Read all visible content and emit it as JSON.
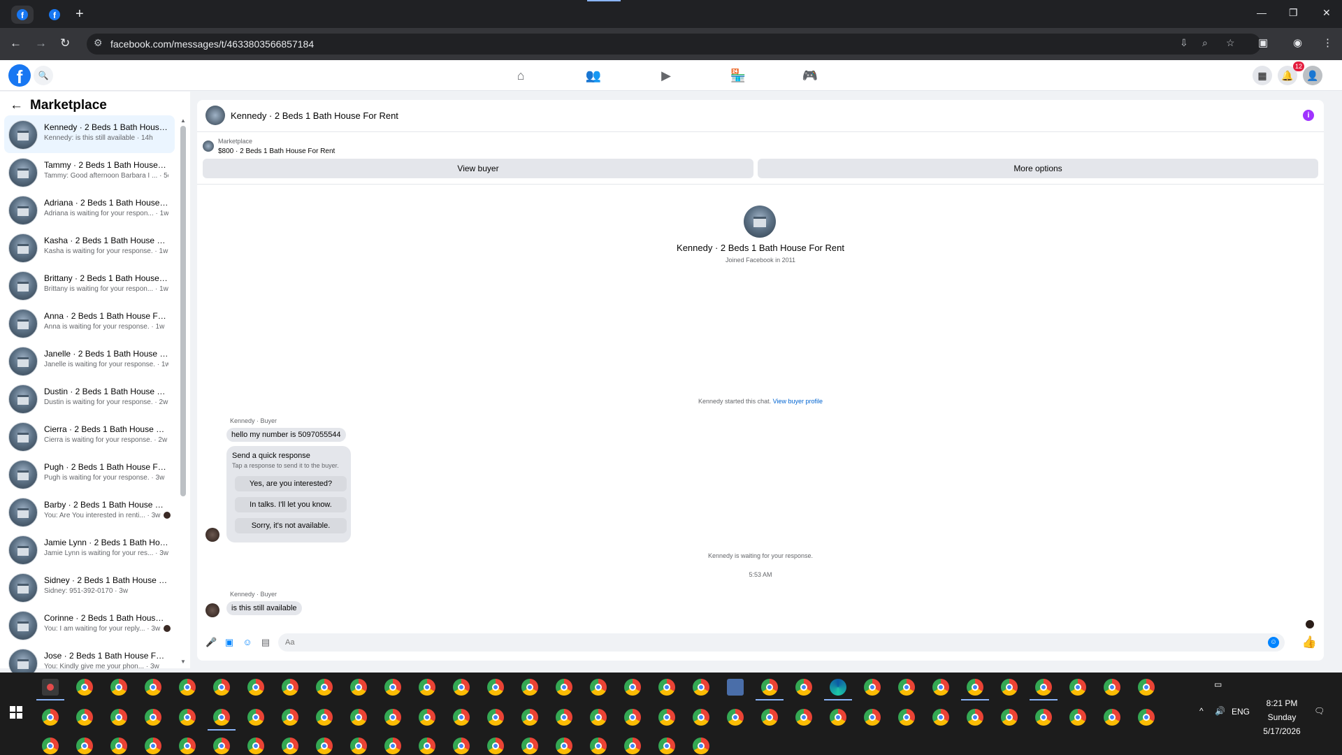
{
  "browser": {
    "url": "facebook.com/messages/t/4633803566857184",
    "tabs": [
      {
        "name": "Facebook tab 1"
      },
      {
        "name": "Facebook tab 2"
      }
    ]
  },
  "fb": {
    "logo": "f",
    "nav_icons": [
      "home-icon",
      "friends-icon",
      "watch-icon",
      "marketplace-icon",
      "gaming-icon"
    ],
    "notifications_count": "12"
  },
  "left": {
    "title": "Marketplace",
    "conversations": [
      {
        "title": "Kennedy · 2 Beds 1 Bath House For Rent",
        "preview": "Kennedy: is this still available · 14h",
        "active": true,
        "dot": false
      },
      {
        "title": "Tammy · 2 Beds 1 Bath House For Rent",
        "preview": "Tammy: Good afternoon Barbara I ... · 5d",
        "active": false,
        "dot": false
      },
      {
        "title": "Adriana · 2 Beds 1 Bath House For Rent",
        "preview": "Adriana is waiting for your respon... · 1w",
        "active": false,
        "dot": false
      },
      {
        "title": "Kasha · 2 Beds 1 Bath House For Rent",
        "preview": "Kasha is waiting for your response. · 1w",
        "active": false,
        "dot": false
      },
      {
        "title": "Brittany · 2 Beds 1 Bath House For Rent",
        "preview": "Brittany is waiting for your respon... · 1w",
        "active": false,
        "dot": false
      },
      {
        "title": "Anna · 2 Beds 1 Bath House For Rent",
        "preview": "Anna is waiting for your response. · 1w",
        "active": false,
        "dot": false
      },
      {
        "title": "Janelle · 2 Beds 1 Bath House For Rent",
        "preview": "Janelle is waiting for your response. · 1w",
        "active": false,
        "dot": false
      },
      {
        "title": "Dustin · 2 Beds 1 Bath House For Rent",
        "preview": "Dustin is waiting for your response. · 2w",
        "active": false,
        "dot": false
      },
      {
        "title": "Cierra · 2 Beds 1 Bath House For Rent",
        "preview": "Cierra is waiting for your response. · 2w",
        "active": false,
        "dot": false
      },
      {
        "title": "Pugh · 2 Beds 1 Bath House For Rent",
        "preview": "Pugh is waiting for your response. · 3w",
        "active": false,
        "dot": false
      },
      {
        "title": "Barby · 2 Beds 1 Bath House For Rent",
        "preview": "You: Are You interested in renti... · 3w",
        "active": false,
        "dot": true
      },
      {
        "title": "Jamie Lynn · 2 Beds 1 Bath House For Rent",
        "preview": "Jamie Lynn is waiting for your res... · 3w",
        "active": false,
        "dot": false
      },
      {
        "title": "Sidney · 2 Beds 1 Bath House For Rent",
        "preview": "Sidney: 951-392-0170 · 3w",
        "active": false,
        "dot": false
      },
      {
        "title": "Corinne · 2 Beds 1 Bath House For Rent",
        "preview": "You: I am waiting for your reply... · 3w",
        "active": false,
        "dot": true
      },
      {
        "title": "Jose · 2 Beds 1 Bath House For Rent",
        "preview": "You: Kindly give me your phon... · 3w",
        "active": false,
        "dot": false
      }
    ]
  },
  "chat": {
    "title": "Kennedy · 2 Beds 1 Bath House For Rent",
    "marketplace_label": "Marketplace",
    "listing": "$800 · 2 Beds 1 Bath House For Rent",
    "view_buyer": "View buyer",
    "more_options": "More options",
    "profile_name": "Kennedy · 2 Beds 1 Bath House For Rent",
    "profile_sub": "Joined Facebook in 2011",
    "started_text": "Kennedy started this chat.",
    "started_link": "View buyer profile",
    "sender_label": "Kennedy · Buyer",
    "msg1": "hello my number is 5097055544",
    "quick_title": "Send a quick response",
    "quick_sub": "Tap a response to send it to the buyer.",
    "quick_options": [
      "Yes, are you interested?",
      "In talks. I'll let you know.",
      "Sorry, it's not available."
    ],
    "waiting": "Kennedy is waiting for your response.",
    "timestamp": "5:53 AM",
    "msg2": "is this still available",
    "composer_placeholder": "Aa"
  },
  "taskbar": {
    "language": "ENG",
    "time": "8:21 PM",
    "day": "Sunday",
    "date": "5/17/2026"
  }
}
